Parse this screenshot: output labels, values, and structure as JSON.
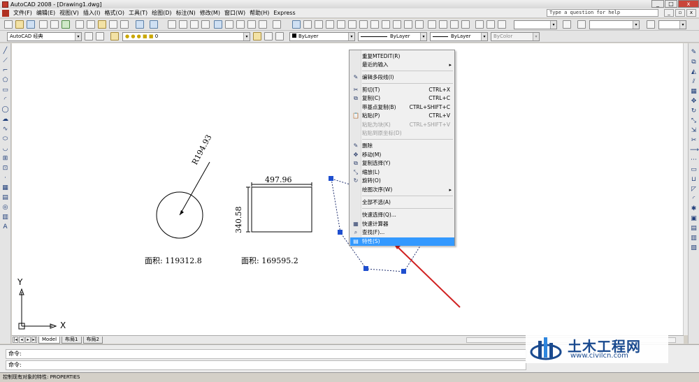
{
  "window": {
    "title": "AutoCAD 2008 - [Drawing1.dwg]",
    "min": "_",
    "max": "□",
    "close": "x"
  },
  "menu": {
    "items": [
      "文件(F)",
      "编辑(E)",
      "视图(V)",
      "插入(I)",
      "格式(O)",
      "工具(T)",
      "绘图(D)",
      "标注(N)",
      "修改(M)",
      "窗口(W)",
      "帮助(H)",
      "Express"
    ]
  },
  "help_search": {
    "placeholder": "Type a question for help"
  },
  "toolbar": {
    "workspace": "AutoCAD 经典",
    "layer": "0",
    "color": "ByLayer",
    "linetype": "ByLayer",
    "lineweight": "ByLayer",
    "plotstyle": "ByColor"
  },
  "drawing": {
    "radius_dim": "R194.93",
    "width_dim": "497.96",
    "height_dim": "340.58",
    "area_circle": "面积: 119312.8",
    "area_rect": "面积: 169595.2",
    "ucs_x": "X",
    "ucs_y": "Y"
  },
  "layout_tabs": {
    "items": [
      "Model",
      "布局1",
      "布局2"
    ],
    "active": "Model"
  },
  "command": {
    "line1": "命令:",
    "line2": "命令:"
  },
  "status": {
    "text": "控制现有对象的特性:  PROPERTIES"
  },
  "context_menu": {
    "items": [
      {
        "label": "重复MTEDIT(R)",
        "shortcut": "",
        "icon": "",
        "disabled": false,
        "submenu": false
      },
      {
        "label": "最近的输入",
        "shortcut": "",
        "icon": "",
        "disabled": false,
        "submenu": true
      },
      {
        "label": "编辑多段线(I)",
        "shortcut": "",
        "icon": "pline-edit-icon",
        "disabled": false,
        "submenu": false
      },
      {
        "label": "剪切(T)",
        "shortcut": "CTRL+X",
        "icon": "scissors-icon",
        "disabled": false,
        "submenu": false
      },
      {
        "label": "复制(C)",
        "shortcut": "CTRL+C",
        "icon": "copy-icon",
        "disabled": false,
        "submenu": false
      },
      {
        "label": "带基点复制(B)",
        "shortcut": "CTRL+SHIFT+C",
        "icon": "",
        "disabled": false,
        "submenu": false
      },
      {
        "label": "粘贴(P)",
        "shortcut": "CTRL+V",
        "icon": "paste-icon",
        "disabled": false,
        "submenu": false
      },
      {
        "label": "粘贴为块(K)",
        "shortcut": "CTRL+SHIFT+V",
        "icon": "",
        "disabled": true,
        "submenu": false
      },
      {
        "label": "粘贴到原坐标(D)",
        "shortcut": "",
        "icon": "",
        "disabled": true,
        "submenu": false
      },
      {
        "label": "删除",
        "shortcut": "",
        "icon": "erase-icon",
        "disabled": false,
        "submenu": false
      },
      {
        "label": "移动(M)",
        "shortcut": "",
        "icon": "move-icon",
        "disabled": false,
        "submenu": false
      },
      {
        "label": "复制选择(Y)",
        "shortcut": "",
        "icon": "copy-select-icon",
        "disabled": false,
        "submenu": false
      },
      {
        "label": "缩放(L)",
        "shortcut": "",
        "icon": "scale-icon",
        "disabled": false,
        "submenu": false
      },
      {
        "label": "旋转(O)",
        "shortcut": "",
        "icon": "rotate-icon",
        "disabled": false,
        "submenu": false
      },
      {
        "label": "绘图次序(W)",
        "shortcut": "",
        "icon": "",
        "disabled": false,
        "submenu": true
      },
      {
        "label": "全部不选(A)",
        "shortcut": "",
        "icon": "",
        "disabled": false,
        "submenu": false
      },
      {
        "label": "快速选择(Q)...",
        "shortcut": "",
        "icon": "",
        "disabled": false,
        "submenu": false
      },
      {
        "label": "快速计算器",
        "shortcut": "",
        "icon": "calculator-icon",
        "disabled": false,
        "submenu": false
      },
      {
        "label": "查找(F)...",
        "shortcut": "",
        "icon": "find-icon",
        "disabled": false,
        "submenu": false
      },
      {
        "label": "特性(S)",
        "shortcut": "",
        "icon": "properties-icon",
        "disabled": false,
        "submenu": false,
        "highlighted": true
      }
    ]
  },
  "watermark": {
    "title": "土木工程网",
    "url": "www.civilcn.com"
  },
  "colors": {
    "highlight": "#3399ff",
    "annotation_arrow": "#d02020",
    "grip": "#1f4fcf"
  }
}
